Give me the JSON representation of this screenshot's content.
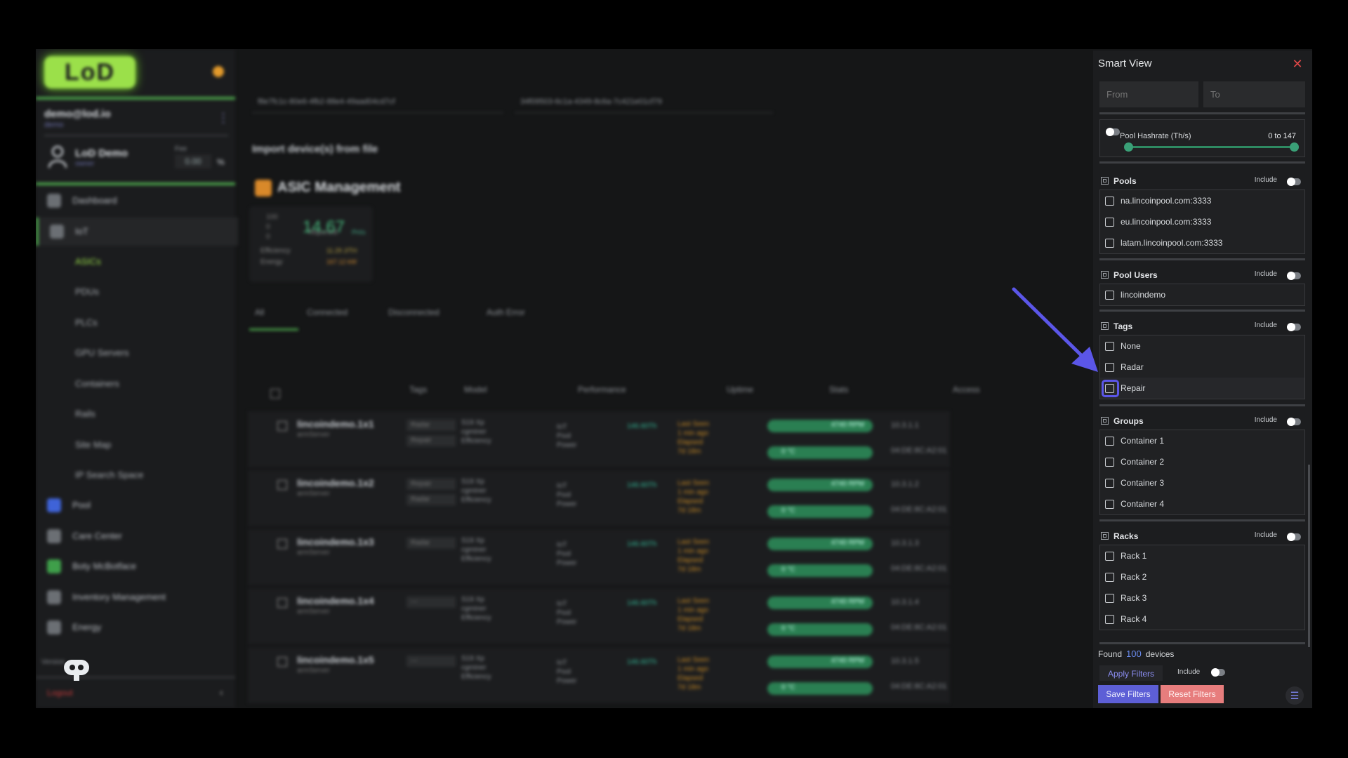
{
  "sidebar": {
    "logo": "LoD",
    "user_email": "demo@lod.io",
    "user_sub": "demo",
    "org_name": "LoD Demo",
    "org_role": "owner",
    "fee_label": "Fee",
    "fee_value": "0.00",
    "fee_unit": "%",
    "nav": [
      {
        "label": "Dashboard"
      },
      {
        "label": "IoT"
      },
      {
        "label": "Pool"
      },
      {
        "label": "Care Center"
      },
      {
        "label": "Boty McBotface"
      },
      {
        "label": "Inventory Management"
      },
      {
        "label": "Energy"
      }
    ],
    "iot_sub": [
      "ASICs",
      "PDUs",
      "PLCs",
      "GPU Servers",
      "Containers",
      "Rails",
      "Site Map",
      "IP Search Space"
    ],
    "version_label": "Version",
    "logout": "Logout"
  },
  "main": {
    "id1": "f8e7fc1c-80e6-4fb2-88e4-49aad04cd7cf",
    "id2": "34f09503-6c1a-4349-8c6a-7c421e01cf79",
    "import_label": "Import device(s) from file",
    "asic_title": "ASIC Management",
    "stats": {
      "total": "100",
      "disconnected": "0",
      "error": "0",
      "hashrate": "14.67",
      "hashrate_label": "Reported",
      "hashrate_unit": "PH/s",
      "efficiency_label": "Efficiency",
      "efficiency": "11.29 J/TH",
      "energy_label": "Energy",
      "energy": "167.12 kW"
    },
    "tabs": [
      "All",
      "Connected",
      "Disconnected",
      "Auth Error"
    ],
    "columns": [
      "Tags",
      "Model",
      "Performance",
      "Uptime",
      "Stats",
      "Access"
    ],
    "rows": [
      {
        "name": "lincoindemo.1x1",
        "sub": "armServer",
        "tags": [
          "Radar",
          "Repair"
        ],
        "ip": "10.3.1.1",
        "mac": "04:DE:8C:A2:01"
      },
      {
        "name": "lincoindemo.1x2",
        "sub": "armServer",
        "tags": [
          "Repair",
          "Radar"
        ],
        "ip": "10.3.1.2",
        "mac": "04:DE:8C:A2:01"
      },
      {
        "name": "lincoindemo.1x3",
        "sub": "armServer",
        "tags": [
          "Radar"
        ],
        "ip": "10.3.1.3",
        "mac": "04:DE:8C:A2:01"
      },
      {
        "name": "lincoindemo.1x4",
        "sub": "armServer",
        "tags": [
          "---"
        ],
        "ip": "10.3.1.4",
        "mac": "04:DE:8C:A2:01"
      },
      {
        "name": "lincoindemo.1x5",
        "sub": "armServer",
        "tags": [
          "---"
        ],
        "ip": "10.3.1.5",
        "mac": "04:DE:8C:A2:01"
      }
    ],
    "row_model": "S19 Xp",
    "row_model_sub": "cgminer",
    "row_efficiency": "Efficiency",
    "row_perf": "IoT\nPool\nPower",
    "row_perf_val": "146.60Th",
    "row_uptime": "Last Seen\n1 min ago\nElapsed\n7d 18m",
    "row_fan": "4740 RPM",
    "row_temp": "0 °C"
  },
  "panel": {
    "title": "Smart View",
    "from_placeholder": "From",
    "to_placeholder": "To",
    "hashrate_label": "Pool Hashrate (Th/s)",
    "hashrate_min": "0",
    "hashrate_to": "to",
    "hashrate_max": "147",
    "include_label": "Include",
    "sections": [
      {
        "title": "Pools",
        "options": [
          "na.lincoinpool.com:3333",
          "eu.lincoinpool.com:3333",
          "latam.lincoinpool.com:3333"
        ]
      },
      {
        "title": "Pool Users",
        "options": [
          "lincoindemo"
        ]
      },
      {
        "title": "Tags",
        "options": [
          "None",
          "Radar",
          "Repair"
        ]
      },
      {
        "title": "Groups",
        "options": [
          "Container 1",
          "Container 2",
          "Container 3",
          "Container 4"
        ]
      },
      {
        "title": "Racks",
        "options": [
          "Rack 1",
          "Rack 2",
          "Rack 3",
          "Rack 4"
        ]
      }
    ],
    "found_prefix": "Found",
    "found_count": "100",
    "found_suffix": "devices",
    "apply_label": "Apply Filters",
    "save_label": "Save Filters",
    "reset_label": "Reset Filters",
    "accent": "#5d5fd6",
    "reset_color": "#e77d7d",
    "annotation_arrow_color": "#5b56e8"
  }
}
